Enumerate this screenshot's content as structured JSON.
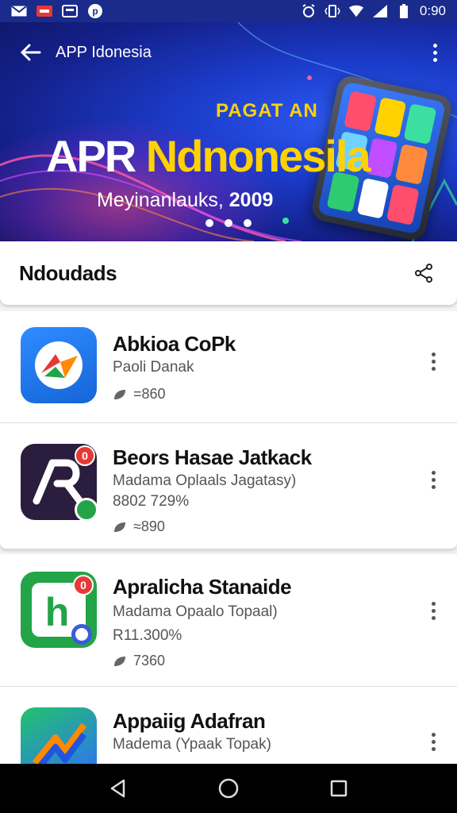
{
  "status_bar": {
    "time": "0:90",
    "icons": [
      "mail-icon",
      "notification-app-icon",
      "screen-icon",
      "pinterest-icon",
      "alarm-icon",
      "vibrate-icon",
      "wifi-icon",
      "signal-icon",
      "battery-icon"
    ]
  },
  "hero": {
    "title": "APP Idonesia",
    "kicker": "PAGAT AN",
    "headline_white": "APR",
    "headline_yellow": "Ndnonesila",
    "subtitle_text": "Meyinanlauks,",
    "subtitle_year": "2009",
    "dots": 3,
    "colors": {
      "background": "#1b3bc9",
      "accent": "#ffd200"
    }
  },
  "section": {
    "title": "Ndoudads",
    "share_icon": "share-icon"
  },
  "apps": [
    {
      "name": "Abkioa CoPk",
      "line1": "Paoli Danak",
      "line2": "",
      "rating": "=860"
    },
    {
      "name": "Beors Hasae Jatkack",
      "line1": "Madama Oplaals Jagatasy)",
      "line2": "8802 729%",
      "rating": "≈890"
    },
    {
      "name": "Apralicha Stanaide",
      "line1": "Madama Opaalo Topaal)",
      "line2": "R11.300%",
      "rating": "7360"
    },
    {
      "name": "Appaiig Adafran",
      "line1": "Madema (Ypaak Topak)",
      "line2": "",
      "rating": ""
    }
  ],
  "nav": {
    "icons": [
      "back-triangle-icon",
      "home-circle-icon",
      "recents-square-icon"
    ]
  }
}
